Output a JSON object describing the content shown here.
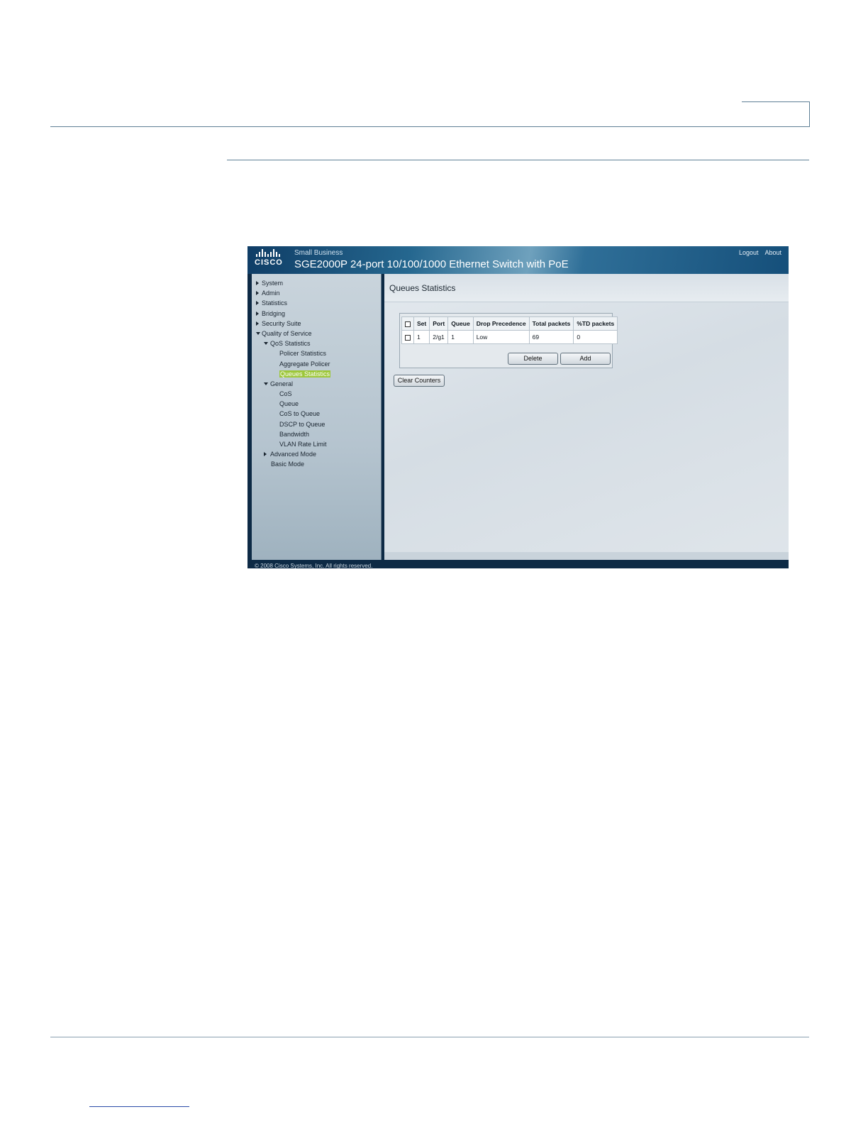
{
  "app": {
    "logo_text": "CISCO",
    "brand": "Small Business",
    "product": "SGE2000P 24-port 10/100/1000 Ethernet Switch with PoE",
    "top_links": [
      "Logout",
      "About"
    ],
    "copyright": "© 2008 Cisco Systems, Inc. All rights reserved."
  },
  "sidebar": {
    "items": [
      {
        "label": "System",
        "level": 0,
        "arrow": "right"
      },
      {
        "label": "Admin",
        "level": 0,
        "arrow": "right"
      },
      {
        "label": "Statistics",
        "level": 0,
        "arrow": "right"
      },
      {
        "label": "Bridging",
        "level": 0,
        "arrow": "right"
      },
      {
        "label": "Security Suite",
        "level": 0,
        "arrow": "right"
      },
      {
        "label": "Quality of Service",
        "level": 0,
        "arrow": "down"
      },
      {
        "label": "QoS Statistics",
        "level": 1,
        "arrow": "down"
      },
      {
        "label": "Policer Statistics",
        "level": 2,
        "arrow": "none"
      },
      {
        "label": "Aggregate Policer",
        "level": 2,
        "arrow": "none"
      },
      {
        "label": "Queues Statistics",
        "level": 2,
        "arrow": "none",
        "active": true
      },
      {
        "label": "General",
        "level": 1,
        "arrow": "down"
      },
      {
        "label": "CoS",
        "level": 2,
        "arrow": "none"
      },
      {
        "label": "Queue",
        "level": 2,
        "arrow": "none"
      },
      {
        "label": "CoS to Queue",
        "level": 2,
        "arrow": "none"
      },
      {
        "label": "DSCP to Queue",
        "level": 2,
        "arrow": "none"
      },
      {
        "label": "Bandwidth",
        "level": 2,
        "arrow": "none"
      },
      {
        "label": "VLAN Rate Limit",
        "level": 2,
        "arrow": "none"
      },
      {
        "label": "Advanced Mode",
        "level": 1,
        "arrow": "right"
      },
      {
        "label": "Basic Mode",
        "level": 1,
        "arrow": "none"
      }
    ],
    "active_color": "#9dc73a"
  },
  "main": {
    "title": "Queues Statistics",
    "table": {
      "headers": [
        "Set",
        "Port",
        "Queue",
        "Drop Precedence",
        "Total packets",
        "%TD packets"
      ],
      "rows": [
        {
          "set": "1",
          "port": "2/g1",
          "queue": "1",
          "drop_precedence": "Low",
          "total_packets": "69",
          "td_packets": "0"
        }
      ]
    },
    "buttons": {
      "delete": "Delete",
      "add": "Add",
      "clear_counters": "Clear Counters"
    }
  }
}
